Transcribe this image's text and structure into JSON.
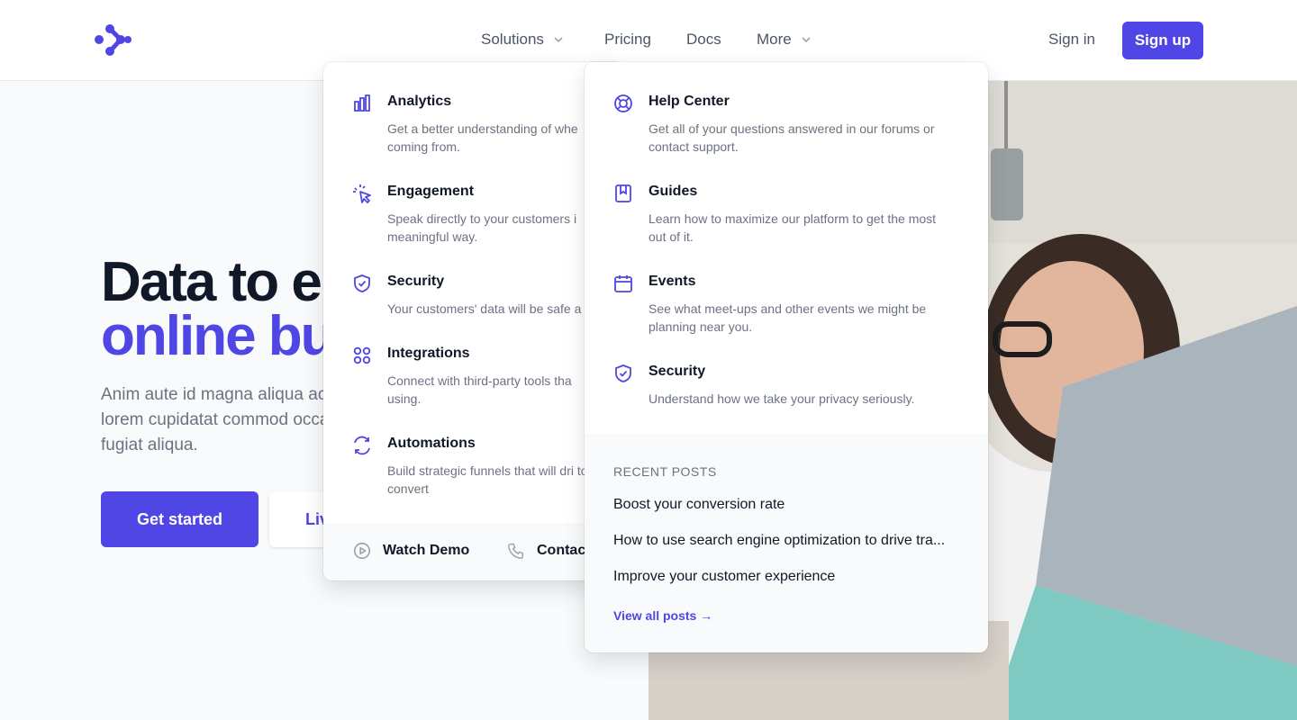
{
  "colors": {
    "brand": "#4f46e5",
    "text": "#111827",
    "muted": "#6b7280",
    "panelFooter": "#f8fafc"
  },
  "header": {
    "nav": {
      "solutions": "Solutions",
      "pricing": "Pricing",
      "docs": "Docs",
      "more": "More"
    },
    "signin": "Sign in",
    "signup": "Sign up"
  },
  "hero": {
    "title_line1": "Data to er",
    "title_line2": "online bus",
    "subtitle": "Anim aute id magna aliqua ac qui lorem cupidatat commod occaecat fugiat aliqua.",
    "primary_button": "Get started",
    "secondary_button": "Liv"
  },
  "solutions_menu": {
    "items": [
      {
        "title": "Analytics",
        "desc": "Get a better understanding of whe coming from.",
        "icon": "bar-chart-icon"
      },
      {
        "title": "Engagement",
        "desc": "Speak directly to your customers i meaningful way.",
        "icon": "cursor-click-icon"
      },
      {
        "title": "Security",
        "desc": "Your customers' data will be safe a",
        "icon": "shield-check-icon"
      },
      {
        "title": "Integrations",
        "desc": "Connect with third-party tools tha using.",
        "icon": "grid-icon"
      },
      {
        "title": "Automations",
        "desc": "Build strategic funnels that will dri to convert",
        "icon": "refresh-icon"
      }
    ],
    "footer": {
      "watch_demo": "Watch Demo",
      "contact": "Contac"
    }
  },
  "more_menu": {
    "items": [
      {
        "title": "Help Center",
        "desc": "Get all of your questions answered in our forums or contact support.",
        "icon": "lifebuoy-icon"
      },
      {
        "title": "Guides",
        "desc": "Learn how to maximize our platform to get the most out of it.",
        "icon": "bookmark-icon"
      },
      {
        "title": "Events",
        "desc": "See what meet-ups and other events we might be planning near you.",
        "icon": "calendar-icon"
      },
      {
        "title": "Security",
        "desc": "Understand how we take your privacy seriously.",
        "icon": "shield-check-icon"
      }
    ],
    "recent_posts": {
      "heading": "RECENT POSTS",
      "posts": [
        "Boost your conversion rate",
        "How to use search engine optimization to drive tra...",
        "Improve your customer experience"
      ],
      "view_all": "View all posts →"
    }
  }
}
